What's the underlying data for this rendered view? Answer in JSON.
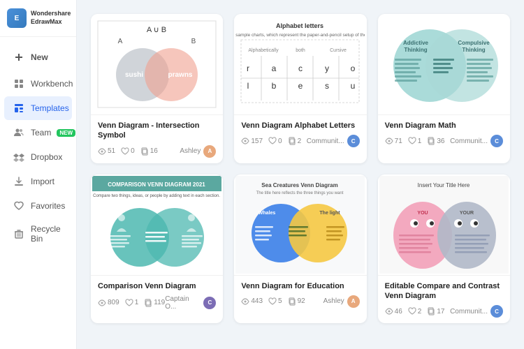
{
  "app": {
    "name": "Wondershare EdrawMax",
    "logo_initials": "E"
  },
  "sidebar": {
    "new_label": "New",
    "items": [
      {
        "id": "workbench",
        "label": "Workbench",
        "icon": "grid-icon",
        "active": false
      },
      {
        "id": "templates",
        "label": "Templates",
        "icon": "template-icon",
        "active": true
      },
      {
        "id": "team",
        "label": "Team",
        "icon": "team-icon",
        "active": false,
        "badge": "NEW"
      },
      {
        "id": "dropbox",
        "label": "Dropbox",
        "icon": "dropbox-icon",
        "active": false
      },
      {
        "id": "import",
        "label": "Import",
        "icon": "import-icon",
        "active": false
      },
      {
        "id": "favorites",
        "label": "Favorites",
        "icon": "heart-icon",
        "active": false
      },
      {
        "id": "recycle",
        "label": "Recycle Bin",
        "icon": "trash-icon",
        "active": false
      }
    ]
  },
  "cards": [
    {
      "id": "venn1",
      "title": "Venn Diagram - Intersection Symbol",
      "views": 51,
      "likes": 0,
      "copies": 16,
      "author_name": "Ashley",
      "author_color": "#e8a87c",
      "author_initial": "A"
    },
    {
      "id": "venn2",
      "title": "Venn Diagram Alphabet Letters",
      "views": 157,
      "likes": 0,
      "copies": 2,
      "author_name": "Communit...",
      "author_color": "#5b8dd9",
      "author_initial": "C"
    },
    {
      "id": "venn3",
      "title": "Venn Diagram Math",
      "views": 71,
      "likes": 1,
      "copies": 36,
      "author_name": "Communit...",
      "author_color": "#5b8dd9",
      "author_initial": "C"
    },
    {
      "id": "venn4",
      "title": "Comparison Venn Diagram",
      "views": 809,
      "likes": 1,
      "copies": 119,
      "author_name": "Captain O...",
      "author_color": "#7c6db5",
      "author_initial": "C"
    },
    {
      "id": "venn5",
      "title": "Venn Diagram for Education",
      "views": 443,
      "likes": 5,
      "copies": 92,
      "author_name": "Ashley",
      "author_color": "#e8a87c",
      "author_initial": "A"
    },
    {
      "id": "venn6",
      "title": "Editable Compare and Contrast Venn Diagram",
      "views": 46,
      "likes": 2,
      "copies": 17,
      "author_name": "Communit...",
      "author_color": "#5b8dd9",
      "author_initial": "C"
    }
  ],
  "icons": {
    "eye": "👁",
    "heart": "♡",
    "copy": "⎘"
  }
}
